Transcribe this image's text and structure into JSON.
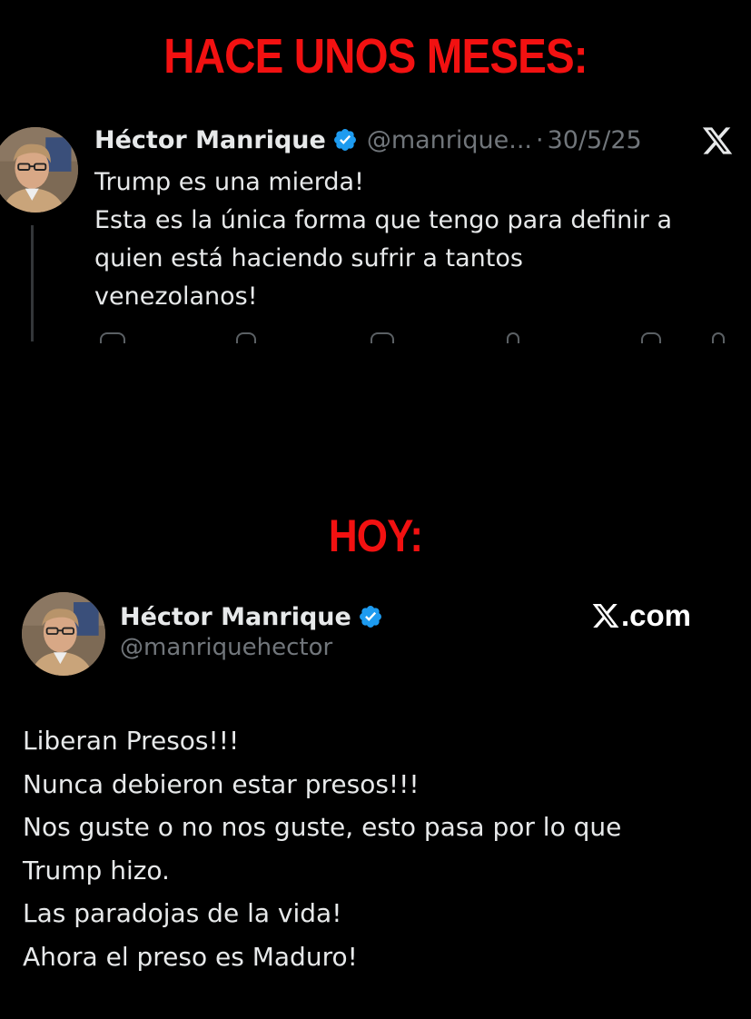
{
  "banners": {
    "top": "HACE UNOS MESES:",
    "bottom": "HOY:"
  },
  "colors": {
    "banner": "#f21111",
    "background": "#000000",
    "text": "#e7e9ea",
    "muted": "#71767b",
    "verified": "#1d9bf0"
  },
  "tweet_old": {
    "author": "Héctor Manrique",
    "handle": "@manrique...",
    "separator": "·",
    "date": "30/5/25",
    "verified_icon": "verified-badge-icon",
    "brand_icon": "x-logo-icon",
    "lines": [
      "Trump es una mierda!",
      "Esta es la única forma que tengo para definir a",
      "quien está haciendo sufrir a tantos",
      "venezolanos!"
    ]
  },
  "tweet_new": {
    "author": "Héctor Manrique",
    "handle": "@manriquehector",
    "brand_text": ".com",
    "brand_icon": "x-logo-icon",
    "lines": [
      "Liberan Presos!!!",
      "Nunca debieron estar presos!!!",
      "Nos guste o no nos guste, esto pasa por lo que",
      "Trump hizo.",
      "Las paradojas de la vida!",
      "Ahora el preso es Maduro!"
    ]
  }
}
